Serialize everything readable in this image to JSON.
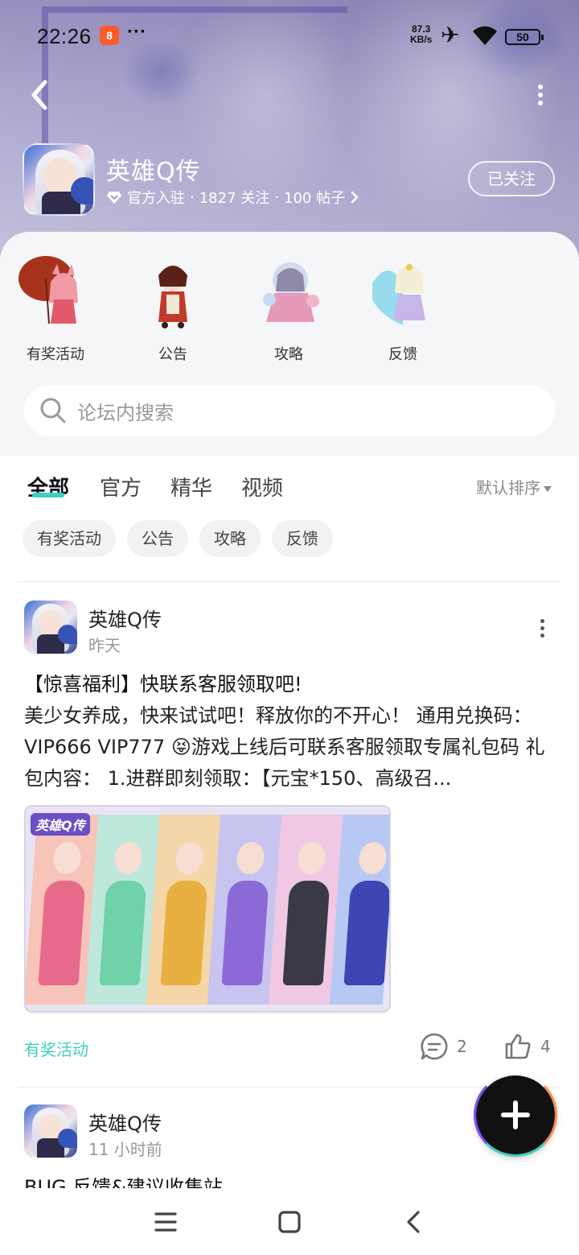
{
  "status_bar": {
    "time": "22:26",
    "app_icon_glyph": "8",
    "dots": "···",
    "net_speed_value": "87.3",
    "net_speed_unit": "KB/s",
    "battery": "50"
  },
  "header": {
    "game_name": "英雄Q传",
    "meta_official": "官方入驻",
    "meta_follows": "1827 关注",
    "meta_posts": "100 帖子",
    "sep": "·",
    "follow_button": "已关注"
  },
  "categories": [
    {
      "label": "有奖活动"
    },
    {
      "label": "公告"
    },
    {
      "label": "攻略"
    },
    {
      "label": "反馈"
    }
  ],
  "search": {
    "placeholder": "论坛内搜索"
  },
  "tabs": [
    {
      "label": "全部",
      "active": true
    },
    {
      "label": "官方"
    },
    {
      "label": "精华"
    },
    {
      "label": "视频"
    }
  ],
  "sort_label": "默认排序",
  "chips": [
    {
      "label": "有奖活动"
    },
    {
      "label": "公告"
    },
    {
      "label": "攻略"
    },
    {
      "label": "反馈"
    }
  ],
  "posts": [
    {
      "author": "英雄Q传",
      "time": "昨天",
      "title": "【惊喜福利】快联系客服领取吧!",
      "body": "美少女养成，快来试试吧！释放你的不开心！ 通用兑换码： VIP666 VIP777 😝游戏上线后可联系客服领取专属礼包码 礼包内容： 1.进群即刻领取：【元宝*150、高级召...",
      "image_logo": "英雄Q传",
      "tag": "有奖活动",
      "comments": "2",
      "likes": "4"
    },
    {
      "author": "英雄Q传",
      "time": "11 小时前",
      "title": "BUG 反馈&建议收集站"
    }
  ],
  "colors": {
    "accent": "#3ecfc0",
    "hero": "#a49cc8"
  }
}
